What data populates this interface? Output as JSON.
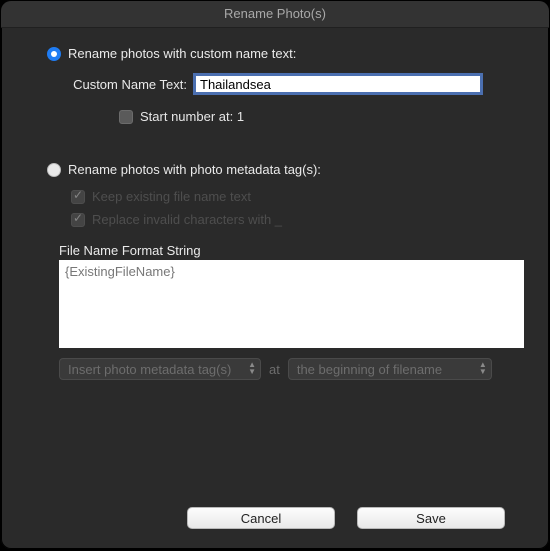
{
  "window": {
    "title": "Rename Photo(s)"
  },
  "option1": {
    "label": "Rename photos with custom name text:",
    "custom_name_label": "Custom Name Text:",
    "custom_name_value": "Thailandsea",
    "start_number_label": "Start number at: 1"
  },
  "option2": {
    "label": "Rename photos with photo metadata tag(s):",
    "keep_existing_label": "Keep existing file name text",
    "replace_invalid_label": "Replace invalid characters with _",
    "format_heading": "File Name Format String",
    "format_value": "{ExistingFileName}",
    "insert_select": "Insert photo metadata tag(s)",
    "at_label": "at",
    "position_select": "the beginning of filename"
  },
  "buttons": {
    "cancel": "Cancel",
    "save": "Save"
  }
}
